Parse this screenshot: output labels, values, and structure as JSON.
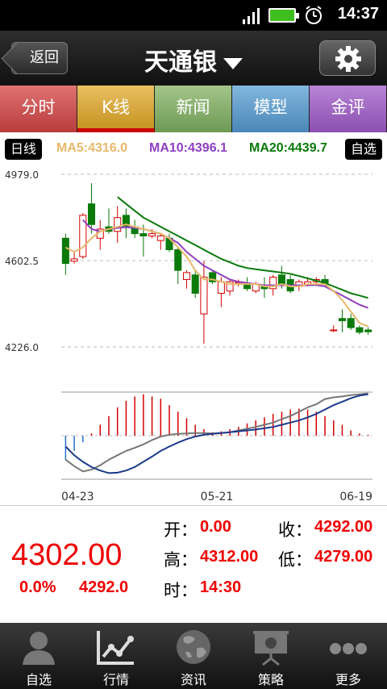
{
  "status_bar": {
    "time": "14:37"
  },
  "header": {
    "back_label": "返回",
    "title": "天通银"
  },
  "tabs": [
    {
      "label": "分时"
    },
    {
      "label": "K线"
    },
    {
      "label": "新闻"
    },
    {
      "label": "模型"
    },
    {
      "label": "金评"
    }
  ],
  "legend": {
    "period_label": "日线",
    "ma5": "MA5:4316.0",
    "ma10": "MA10:4396.1",
    "ma20": "MA20:4439.7",
    "watch_label": "自选",
    "colors": {
      "ma5": "#e8b86a",
      "ma10": "#8e3fc0",
      "ma20": "#0a7a0a",
      "up": "#d40000",
      "down": "#0a7a0a"
    }
  },
  "chart_data": {
    "type": "candlestick",
    "y_ticks": [
      "4979.0",
      "4602.5",
      "4226.0"
    ],
    "ylim": [
      4226.0,
      4979.0
    ],
    "x_labels": [
      "04-23",
      "05-21",
      "06-19"
    ],
    "candles": [
      {
        "o": 4700,
        "h": 4720,
        "l": 4540,
        "c": 4590
      },
      {
        "o": 4600,
        "h": 4640,
        "l": 4590,
        "c": 4610
      },
      {
        "o": 4620,
        "h": 4810,
        "l": 4610,
        "c": 4800
      },
      {
        "o": 4850,
        "h": 4940,
        "l": 4720,
        "c": 4760
      },
      {
        "o": 4700,
        "h": 4780,
        "l": 4650,
        "c": 4740
      },
      {
        "o": 4750,
        "h": 4830,
        "l": 4720,
        "c": 4730
      },
      {
        "o": 4730,
        "h": 4840,
        "l": 4680,
        "c": 4790
      },
      {
        "o": 4800,
        "h": 4830,
        "l": 4700,
        "c": 4750
      },
      {
        "o": 4750,
        "h": 4780,
        "l": 4700,
        "c": 4720
      },
      {
        "o": 4720,
        "h": 4760,
        "l": 4620,
        "c": 4710
      },
      {
        "o": 4710,
        "h": 4740,
        "l": 4700,
        "c": 4720
      },
      {
        "o": 4690,
        "h": 4720,
        "l": 4650,
        "c": 4710
      },
      {
        "o": 4700,
        "h": 4720,
        "l": 4640,
        "c": 4650
      },
      {
        "o": 4650,
        "h": 4660,
        "l": 4500,
        "c": 4560
      },
      {
        "o": 4520,
        "h": 4560,
        "l": 4480,
        "c": 4550
      },
      {
        "o": 4540,
        "h": 4560,
        "l": 4440,
        "c": 4460
      },
      {
        "o": 4370,
        "h": 4600,
        "l": 4240,
        "c": 4530
      },
      {
        "o": 4550,
        "h": 4560,
        "l": 4500,
        "c": 4510
      },
      {
        "o": 4460,
        "h": 4530,
        "l": 4400,
        "c": 4510
      },
      {
        "o": 4470,
        "h": 4520,
        "l": 4450,
        "c": 4510
      },
      {
        "o": 4510,
        "h": 4520,
        "l": 4490,
        "c": 4510
      },
      {
        "o": 4500,
        "h": 4530,
        "l": 4470,
        "c": 4480
      },
      {
        "o": 4470,
        "h": 4510,
        "l": 4460,
        "c": 4500
      },
      {
        "o": 4490,
        "h": 4530,
        "l": 4440,
        "c": 4480
      },
      {
        "o": 4480,
        "h": 4540,
        "l": 4450,
        "c": 4530
      },
      {
        "o": 4540,
        "h": 4580,
        "l": 4480,
        "c": 4500
      },
      {
        "o": 4520,
        "h": 4540,
        "l": 4460,
        "c": 4470
      },
      {
        "o": 4490,
        "h": 4520,
        "l": 4470,
        "c": 4510
      },
      {
        "o": 4500,
        "h": 4530,
        "l": 4490,
        "c": 4510
      },
      {
        "o": 4510,
        "h": 4530,
        "l": 4500,
        "c": 4520
      },
      {
        "o": 4520,
        "h": 4540,
        "l": 4490,
        "c": 4500
      },
      {
        "o": 4300,
        "h": 4320,
        "l": 4290,
        "c": 4300
      },
      {
        "o": 4350,
        "h": 4390,
        "l": 4290,
        "c": 4340
      },
      {
        "o": 4350,
        "h": 4370,
        "l": 4300,
        "c": 4310
      },
      {
        "o": 4310,
        "h": 4320,
        "l": 4280,
        "c": 4290
      },
      {
        "o": 4300,
        "h": 4312,
        "l": 4279,
        "c": 4292
      }
    ],
    "ma5": [
      4660,
      4640,
      4660,
      4700,
      4730,
      4740,
      4750,
      4760,
      4750,
      4740,
      4730,
      4720,
      4700,
      4660,
      4620,
      4560,
      4520,
      4520,
      4510,
      4500,
      4500,
      4500,
      4500,
      4490,
      4490,
      4500,
      4490,
      4490,
      4500,
      4500,
      4500,
      4470,
      4430,
      4380,
      4330,
      4316
    ],
    "ma10": [
      null,
      null,
      4780,
      4740,
      4730,
      4740,
      4745,
      4748,
      4745,
      4740,
      4730,
      4720,
      4700,
      4680,
      4640,
      4610,
      4580,
      4560,
      4540,
      4520,
      4510,
      4505,
      4500,
      4495,
      4495,
      4495,
      4495,
      4495,
      4495,
      4496,
      4490,
      4470,
      4450,
      4430,
      4410,
      4396.1
    ],
    "ma20": [
      null,
      null,
      null,
      null,
      null,
      null,
      4880,
      4850,
      4820,
      4790,
      4770,
      4750,
      4730,
      4710,
      4690,
      4670,
      4650,
      4630,
      4610,
      4595,
      4580,
      4570,
      4565,
      4560,
      4555,
      4550,
      4545,
      4535,
      4525,
      4515,
      4505,
      4490,
      4475,
      4460,
      4450,
      4439.7
    ],
    "macd_hist": [
      -0.55,
      -0.35,
      -0.15,
      0.05,
      0.25,
      0.45,
      0.65,
      0.8,
      0.9,
      0.95,
      0.9,
      0.85,
      0.7,
      0.55,
      0.4,
      0.25,
      0.15,
      0.08,
      0.1,
      0.15,
      0.2,
      0.28,
      0.35,
      0.42,
      0.5,
      0.55,
      0.6,
      0.62,
      0.6,
      0.55,
      0.45,
      0.35,
      0.25,
      0.12,
      0.05,
      0.02
    ],
    "dif": [
      -0.55,
      -0.7,
      -0.82,
      -0.78,
      -0.68,
      -0.55,
      -0.45,
      -0.35,
      -0.28,
      -0.2,
      -0.1,
      -0.02,
      0.02,
      0.04,
      0.05,
      0.06,
      0.06,
      0.05,
      0.06,
      0.08,
      0.12,
      0.16,
      0.2,
      0.25,
      0.3,
      0.38,
      0.45,
      0.55,
      0.65,
      0.72,
      0.84,
      0.88,
      0.9,
      0.93,
      0.95,
      0.97
    ],
    "dea": [
      -0.25,
      -0.45,
      -0.6,
      -0.72,
      -0.8,
      -0.86,
      -0.85,
      -0.8,
      -0.72,
      -0.6,
      -0.48,
      -0.35,
      -0.25,
      -0.16,
      -0.08,
      -0.02,
      0.02,
      0.04,
      0.06,
      0.08,
      0.1,
      0.12,
      0.14,
      0.17,
      0.2,
      0.25,
      0.3,
      0.35,
      0.42,
      0.5,
      0.6,
      0.7,
      0.78,
      0.86,
      0.92,
      0.95
    ],
    "macd_range": [
      -1.0,
      1.0
    ]
  },
  "quote": {
    "price": "4302.00",
    "change_pct": "0.0%",
    "prev": "4292.0",
    "open_label": "开：",
    "open": "0.00",
    "close_label": "收：",
    "close": "4292.00",
    "high_label": "高：",
    "high": "4312.00",
    "low_label": "低：",
    "low": "4279.00",
    "time_label": "时：",
    "time": "14:30"
  },
  "bottom_nav": [
    {
      "label": "自选",
      "icon": "person-icon"
    },
    {
      "label": "行情",
      "icon": "chart-icon"
    },
    {
      "label": "资讯",
      "icon": "globe-icon"
    },
    {
      "label": "策略",
      "icon": "presentation-icon"
    },
    {
      "label": "更多",
      "icon": "more-icon"
    }
  ]
}
